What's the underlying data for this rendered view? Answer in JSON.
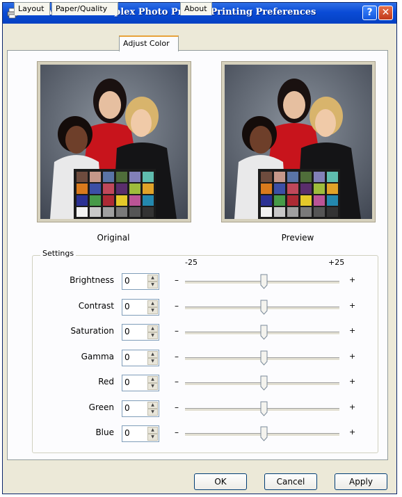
{
  "window": {
    "title": "KODAK D4000 Duplex Photo Printer Printing Preferences",
    "help_label": "?",
    "close_label": "✕"
  },
  "tabs": [
    {
      "label": "Layout",
      "active": false
    },
    {
      "label": "Paper/Quality",
      "active": false
    },
    {
      "label": "Adjust Color",
      "active": true
    },
    {
      "label": "About",
      "active": false
    }
  ],
  "images": {
    "original_caption": "Original",
    "preview_caption": "Preview"
  },
  "settings": {
    "group_label": "Settings",
    "scale_min": "-25",
    "scale_max": "+25",
    "minus_symbol": "–",
    "plus_symbol": "+",
    "rows": [
      {
        "label": "Brightness",
        "value": "0"
      },
      {
        "label": "Contrast",
        "value": "0"
      },
      {
        "label": "Saturation",
        "value": "0"
      },
      {
        "label": "Gamma",
        "value": "0"
      },
      {
        "label": "Red",
        "value": "0"
      },
      {
        "label": "Green",
        "value": "0"
      },
      {
        "label": "Blue",
        "value": "0"
      }
    ]
  },
  "buttons": {
    "ok": "OK",
    "cancel": "Cancel",
    "apply": "Apply"
  }
}
